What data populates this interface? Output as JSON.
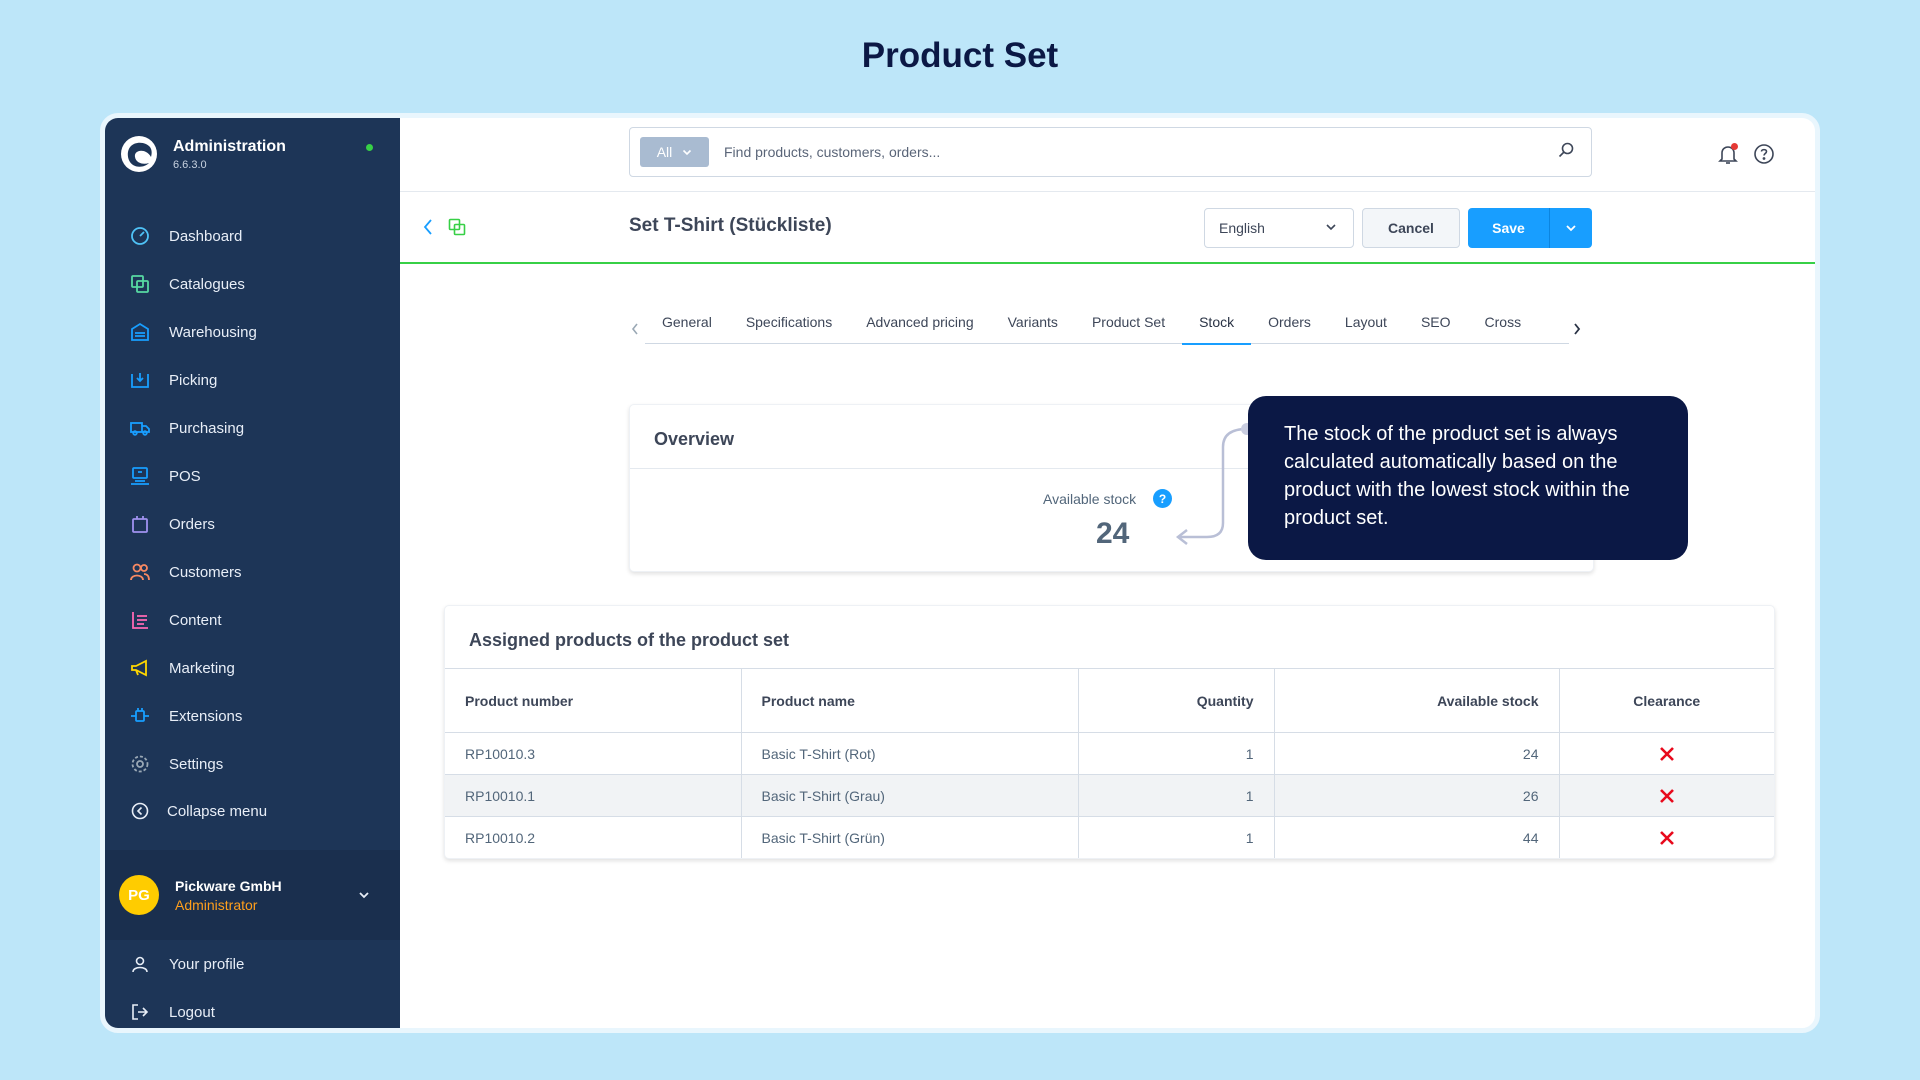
{
  "page_heading": "Product Set",
  "brand": {
    "name": "Administration",
    "version": "6.6.3.0"
  },
  "nav": {
    "items": [
      {
        "label": "Dashboard",
        "icon": "dashboard-icon",
        "color": "#4fc3f7"
      },
      {
        "label": "Catalogues",
        "icon": "catalogues-icon",
        "color": "#57d9a3"
      },
      {
        "label": "Warehousing",
        "icon": "warehouse-icon",
        "color": "#189eff"
      },
      {
        "label": "Picking",
        "icon": "picking-icon",
        "color": "#189eff"
      },
      {
        "label": "Purchasing",
        "icon": "truck-icon",
        "color": "#189eff"
      },
      {
        "label": "POS",
        "icon": "pos-icon",
        "color": "#189eff"
      },
      {
        "label": "Orders",
        "icon": "orders-bag-icon",
        "color": "#a092f0"
      },
      {
        "label": "Customers",
        "icon": "customers-icon",
        "color": "#f88962"
      },
      {
        "label": "Content",
        "icon": "content-icon",
        "color": "#ff68b4"
      },
      {
        "label": "Marketing",
        "icon": "megaphone-icon",
        "color": "#ffd700"
      },
      {
        "label": "Extensions",
        "icon": "plug-icon",
        "color": "#189eff"
      },
      {
        "label": "Settings",
        "icon": "gear-icon",
        "color": "#9aa8b5"
      }
    ],
    "collapse_label": "Collapse menu"
  },
  "user": {
    "initials": "PG",
    "name": "Pickware GmbH",
    "role": "Administrator"
  },
  "account_links": [
    {
      "label": "Your profile",
      "icon": "user-icon"
    },
    {
      "label": "Logout",
      "icon": "logout-icon"
    }
  ],
  "search": {
    "type_label": "All",
    "placeholder": "Find products, customers, orders..."
  },
  "smartbar": {
    "title": "Set T-Shirt (Stückliste)",
    "language": "English",
    "cancel_label": "Cancel",
    "save_label": "Save"
  },
  "tabs": [
    {
      "label": "General",
      "active": false
    },
    {
      "label": "Specifications",
      "active": false
    },
    {
      "label": "Advanced pricing",
      "active": false
    },
    {
      "label": "Variants",
      "active": false
    },
    {
      "label": "Product Set",
      "active": false
    },
    {
      "label": "Stock",
      "active": true
    },
    {
      "label": "Orders",
      "active": false
    },
    {
      "label": "Layout",
      "active": false
    },
    {
      "label": "SEO",
      "active": false
    },
    {
      "label": "Cross",
      "active": false
    }
  ],
  "overview": {
    "title": "Overview",
    "available_stock_label": "Available stock",
    "help_glyph": "?",
    "available_stock_value": "24"
  },
  "callout": {
    "text": "The stock of the product set is always calculated automatically based on the product with the lowest stock within the product set."
  },
  "assigned": {
    "title": "Assigned products of the product set",
    "columns": [
      "Product number",
      "Product name",
      "Quantity",
      "Available stock",
      "Clearance"
    ],
    "rows": [
      {
        "number": "RP10010.3",
        "name": "Basic T-Shirt (Rot)",
        "quantity": "1",
        "stock": "24",
        "clearance": false
      },
      {
        "number": "RP10010.1",
        "name": "Basic T-Shirt (Grau)",
        "quantity": "1",
        "stock": "26",
        "clearance": false
      },
      {
        "number": "RP10010.2",
        "name": "Basic T-Shirt (Grün)",
        "quantity": "1",
        "stock": "44",
        "clearance": false
      }
    ]
  },
  "colors": {
    "accent": "#189eff",
    "sidebar": "#1d3557",
    "success": "#37d046",
    "clearance_no": "#e8091c",
    "callout_bg": "#0b1845"
  }
}
